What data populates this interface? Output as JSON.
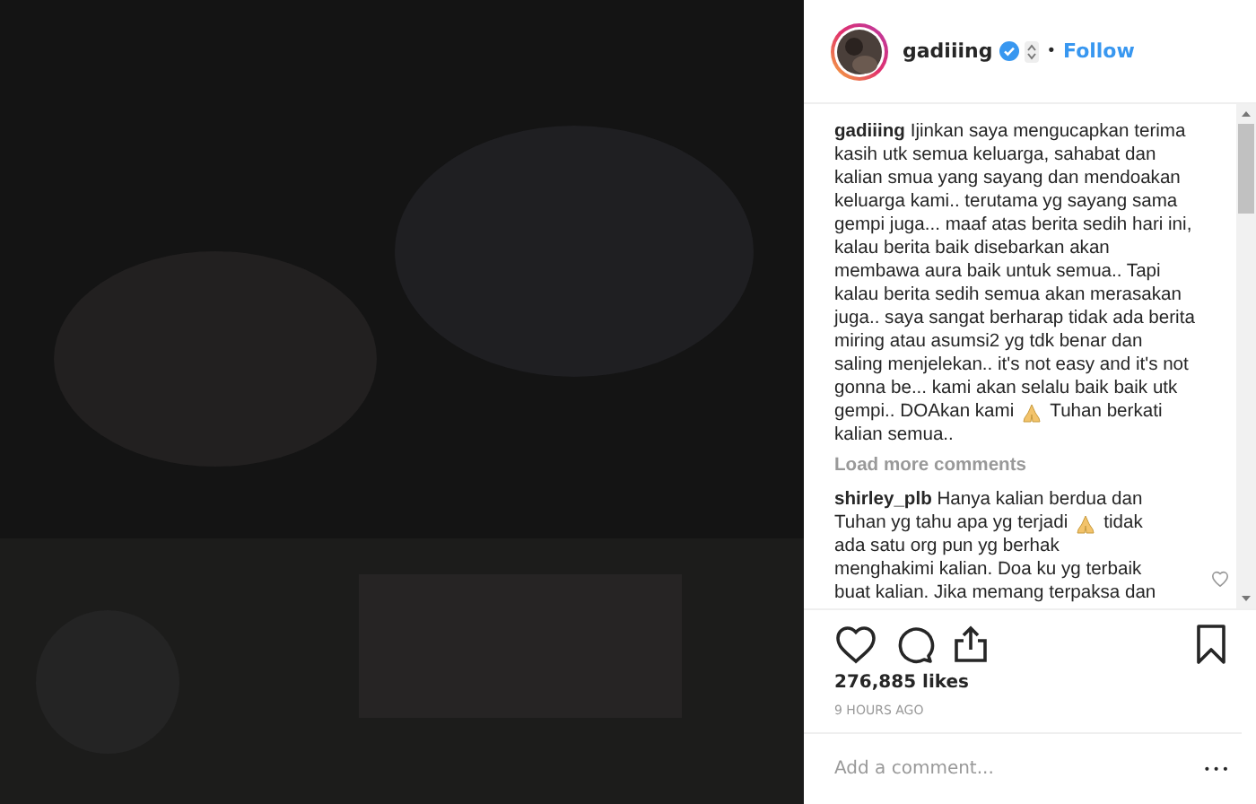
{
  "header": {
    "username": "gadiiing",
    "verified": true,
    "separator": "•",
    "follow": "Follow"
  },
  "caption": [
    {
      "kind": "text",
      "text": "**gadiiing** Ijinkan saya mengucapkan terima"
    },
    {
      "kind": "text",
      "text": "kasih utk semua keluarga, sahabat dan"
    },
    {
      "kind": "text",
      "text": "kalian smua yang sayang dan mendoakan"
    },
    {
      "kind": "text",
      "text": "keluarga kami.. terutama yg sayang sama"
    },
    {
      "kind": "text",
      "text": "gempi juga... maaf atas berita sedih hari ini,"
    },
    {
      "kind": "text",
      "text": "kalau berita baik disebarkan akan"
    },
    {
      "kind": "text",
      "text": "membawa aura baik untuk semua.. Tapi"
    },
    {
      "kind": "text",
      "text": "kalau berita sedih semua akan merasakan"
    },
    {
      "kind": "text",
      "text": "juga.. saya sangat berharap tidak ada berita"
    },
    {
      "kind": "text",
      "text": "miring atau asumsi2 yg tdk benar dan"
    },
    {
      "kind": "text",
      "text": "saling menjelekan.. it's not easy and it's not"
    },
    {
      "kind": "text",
      "text": "gonna be... kami akan selalu baik baik utk"
    },
    {
      "kind": "mixed",
      "parts": [
        {
          "kind": "text",
          "text": "gempi.. DOAkan kami"
        },
        {
          "kind": "pray"
        },
        {
          "kind": "text",
          "text": "Tuhan berkati"
        }
      ]
    },
    {
      "kind": "text",
      "text": "kalian semua.."
    }
  ],
  "load_more": "Load more comments",
  "comments": [
    {
      "lines": [
        {
          "kind": "text",
          "text": "**shirley_plb** Hanya kalian berdua dan"
        },
        {
          "kind": "mixed",
          "parts": [
            {
              "kind": "text",
              "text": "Tuhan yg tahu apa yg terjadi"
            },
            {
              "kind": "pray"
            },
            {
              "kind": "text",
              "text": "tidak"
            }
          ]
        },
        {
          "kind": "text",
          "text": "ada satu org pun yg berhak"
        },
        {
          "kind": "text",
          "text": "menghakimi kalian. Doa ku yg terbaik"
        },
        {
          "kind": "text",
          "text": "buat kalian. Jika memang terpaksa dan"
        }
      ],
      "liked": false
    }
  ],
  "likes": "276,885 likes",
  "time": "9 HOURS AGO",
  "comment_box": {
    "placeholder": "Add a comment..."
  },
  "more": "•••"
}
